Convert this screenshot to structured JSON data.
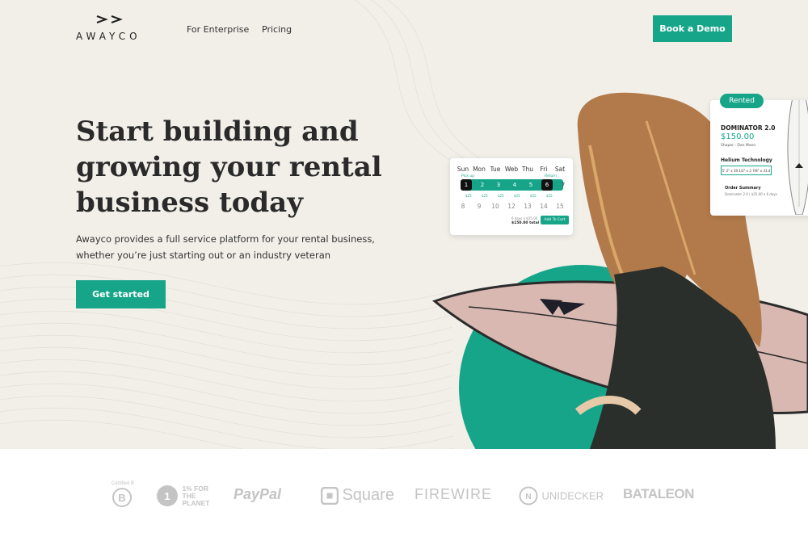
{
  "header": {
    "brand": "AWAYCO",
    "nav": [
      {
        "label": "For Enterprise"
      },
      {
        "label": "Pricing"
      }
    ],
    "demo_label": "Book a Demo"
  },
  "hero": {
    "headline": "Start building and growing your rental business today",
    "subtext": "Awayco provides a full service platform for your rental business, whether you’re just starting out or an industry veteran",
    "cta_label": "Get started"
  },
  "booking_card": {
    "weekdays": [
      "Sun",
      "Mon",
      "Tue",
      "Web",
      "Thu",
      "Fri",
      "Sat"
    ],
    "pickup_label": "Pick up",
    "return_label": "Return",
    "row1": [
      "1",
      "2",
      "3",
      "4",
      "5",
      "6",
      "7"
    ],
    "prices": [
      "$25",
      "$25",
      "$25",
      "$25",
      "$25",
      "$25"
    ],
    "row2": [
      "8",
      "9",
      "10",
      "12",
      "13",
      "14",
      "15"
    ],
    "total_detail": "6 days x $25.00",
    "total": "$150.00 total",
    "cart_label": "Add To Cart"
  },
  "rented_card": {
    "badge": "Rented",
    "title": "DOMINATOR 2.0",
    "price": "$150.00",
    "shaper": "Shaper - Dan Mann",
    "tech": "Helium Technology",
    "dims": "5' 2\" x 19 1/2\" x 2 7/8\" x 33.4",
    "summary": "Order Summary",
    "summary_line": "Dominator 2.0 | $25.00 x 6 days"
  },
  "partners": [
    {
      "name": "Certified B",
      "icon": "b-corp-logo"
    },
    {
      "name": "1% FOR THE PLANET",
      "icon": "one-percent-logo"
    },
    {
      "name": "PayPal",
      "icon": "paypal-logo"
    },
    {
      "name": "Square",
      "icon": "square-logo"
    },
    {
      "name": "FIREWIRE",
      "icon": "firewire-logo"
    },
    {
      "name": "UNIDECKER",
      "icon": "unidecker-logo"
    },
    {
      "name": "BATALEON",
      "icon": "bataleon-logo"
    }
  ],
  "colors": {
    "accent": "#17a58a",
    "hero_bg": "#f2efe9",
    "logo_gray": "#c4c4c4"
  }
}
